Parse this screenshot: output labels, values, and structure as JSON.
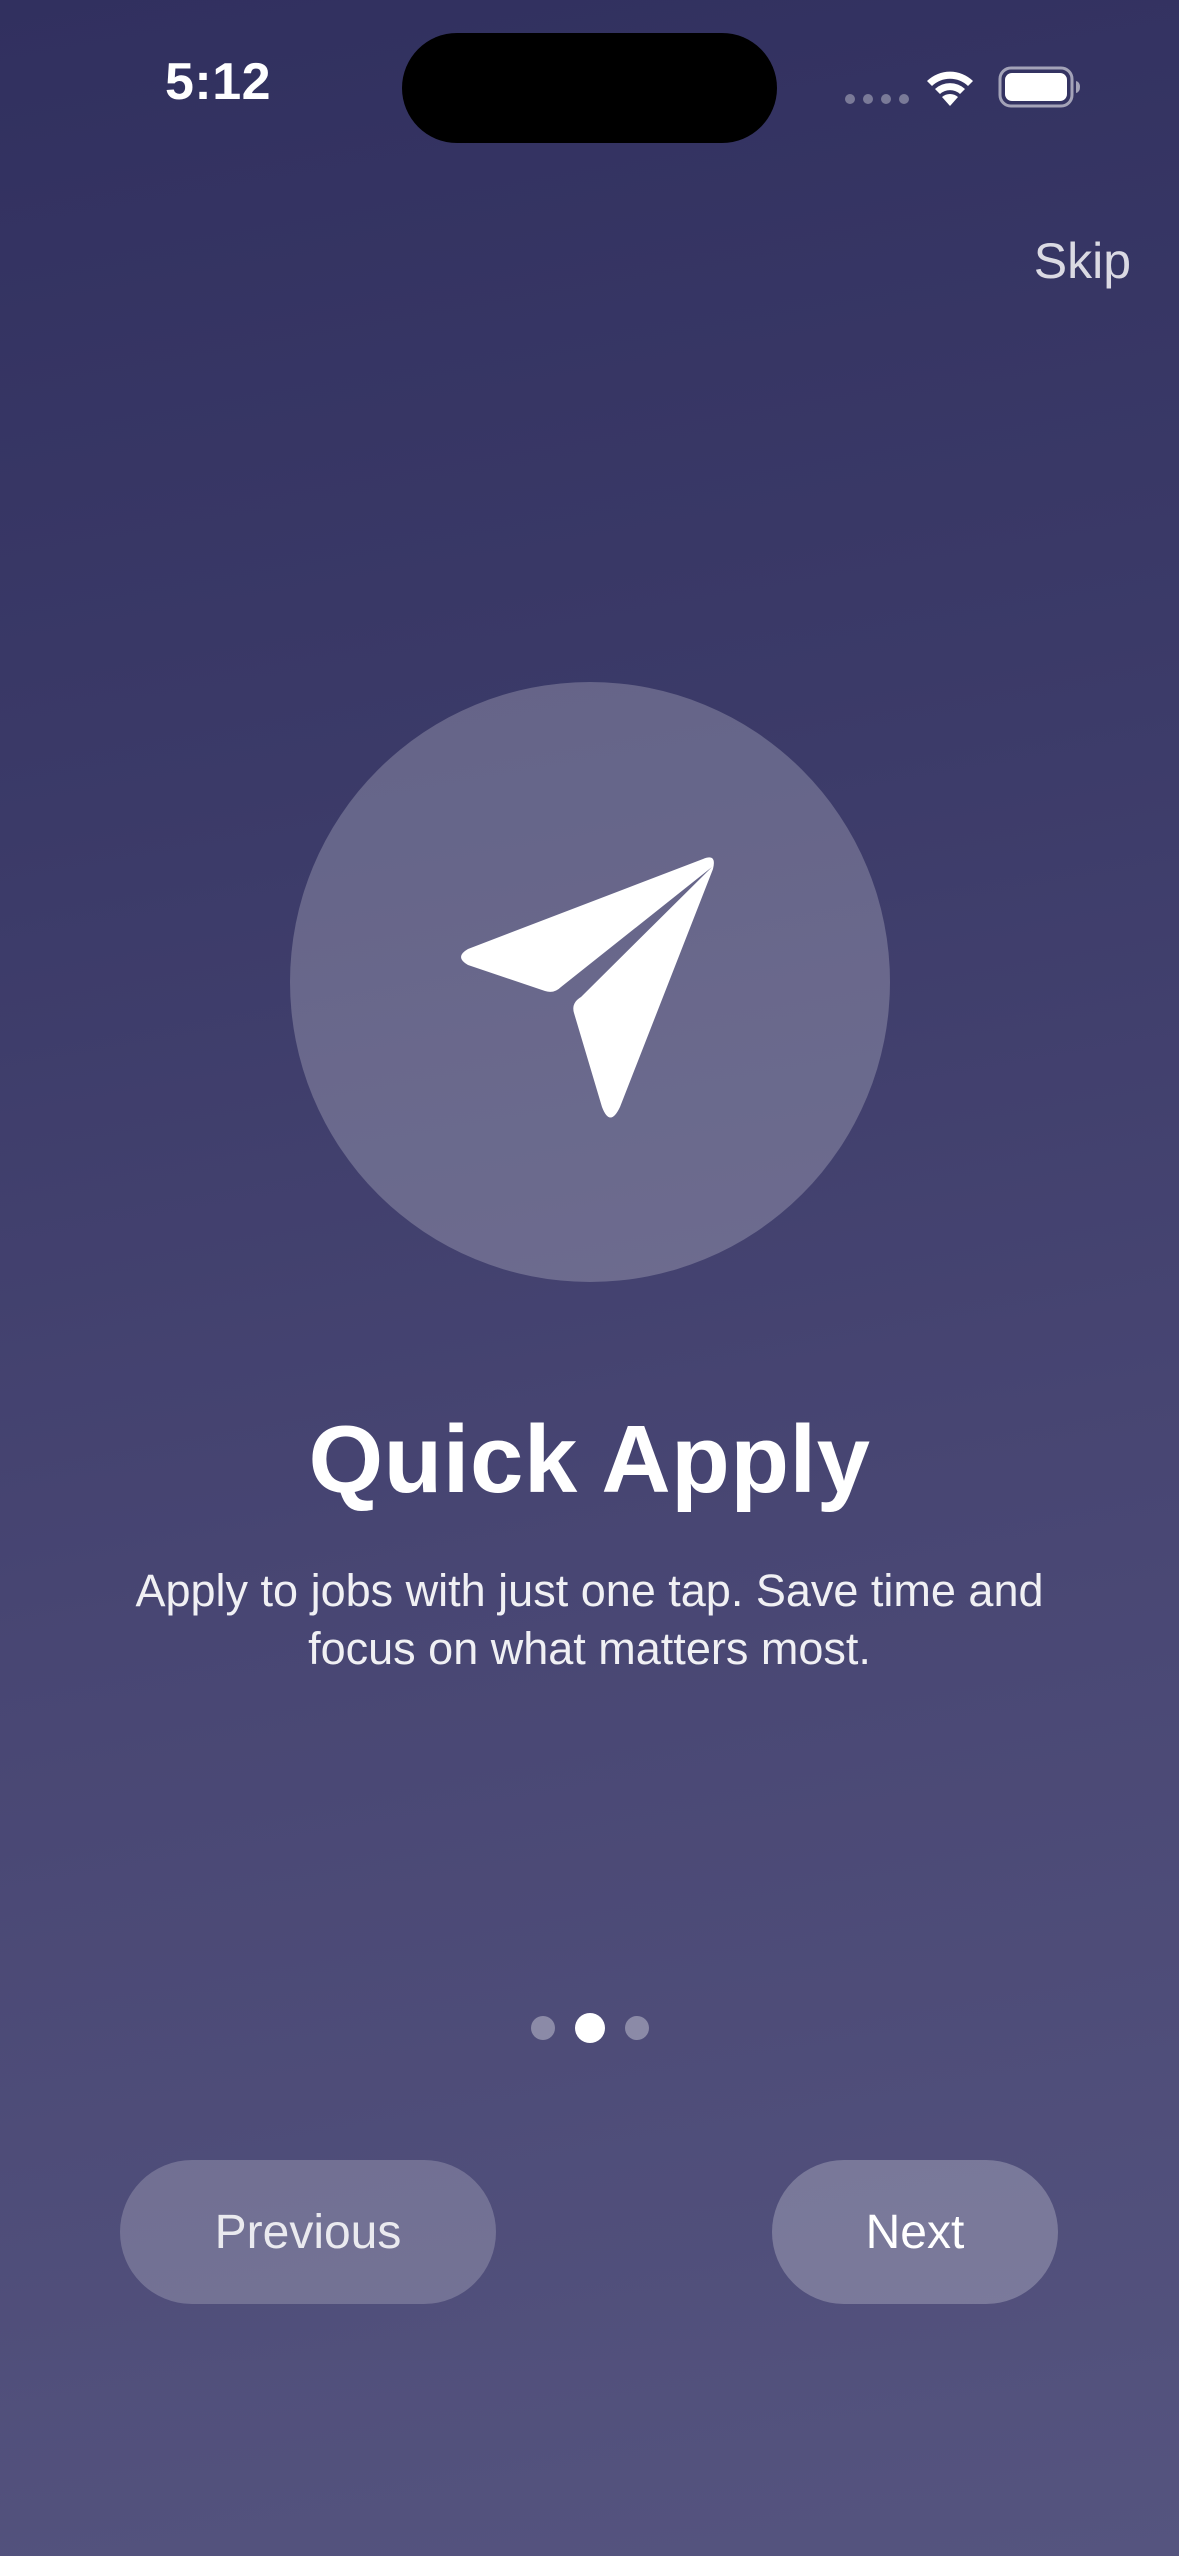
{
  "status_bar": {
    "time": "5:12"
  },
  "header": {
    "skip_label": "Skip"
  },
  "hero": {
    "icon": "paper-plane-icon"
  },
  "content": {
    "title": "Quick Apply",
    "description": "Apply to jobs with just one tap. Save time and focus on what matters most."
  },
  "pager": {
    "total_pages": 3,
    "current_page": 2
  },
  "footer": {
    "previous_label": "Previous",
    "next_label": "Next"
  },
  "colors": {
    "background_top": "#31305f",
    "background_bottom": "#55547f",
    "text": "#ffffff"
  }
}
